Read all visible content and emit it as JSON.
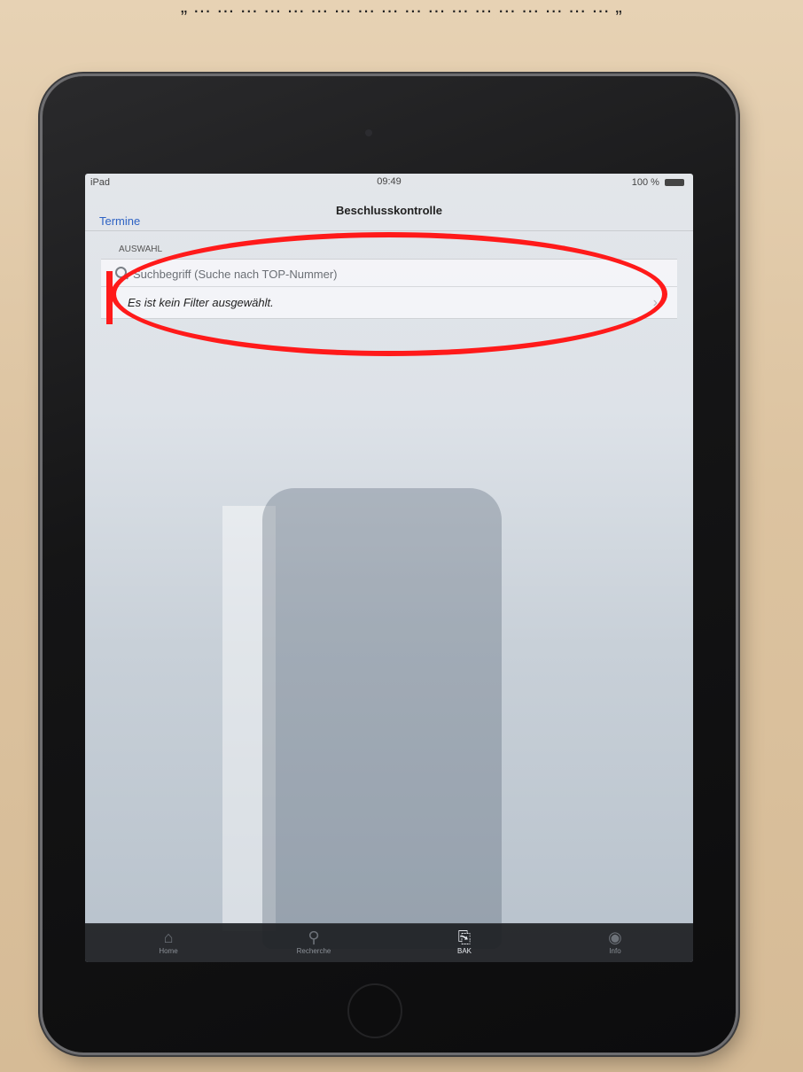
{
  "caption": "„ ... ... ... ... ... ... ... ... ... ... ... ... ... ... ... ... ... ... „",
  "status_bar": {
    "carrier": "iPad",
    "time": "09:49",
    "battery": "100 %"
  },
  "nav": {
    "back_label": "Termine",
    "title": "Beschlusskontrolle"
  },
  "section": {
    "header": "AUSWAHL"
  },
  "search": {
    "placeholder": "Suchbegriff (Suche nach TOP-Nummer)"
  },
  "filter": {
    "text": "Es ist kein Filter ausgewählt."
  },
  "tabs": [
    {
      "label": "Home",
      "icon": "home-icon"
    },
    {
      "label": "Recherche",
      "icon": "search-icon"
    },
    {
      "label": "BAK",
      "icon": "document-search-icon",
      "active": true
    },
    {
      "label": "Info",
      "icon": "globe-icon"
    }
  ],
  "colors": {
    "accent": "#2e62c4",
    "annotation": "#ff1a1a"
  }
}
